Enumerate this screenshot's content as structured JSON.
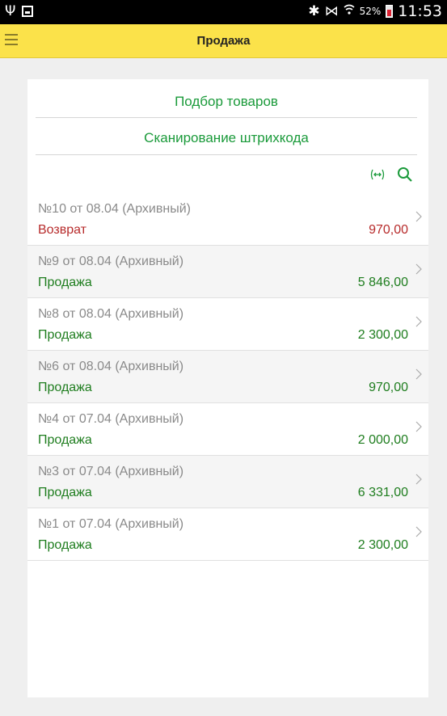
{
  "status_bar": {
    "battery": "52%",
    "time": "11:53"
  },
  "header": {
    "title": "Продажа"
  },
  "actions": {
    "pick_goods": "Подбор товаров",
    "scan_barcode": "Сканирование штрихкода"
  },
  "documents": [
    {
      "title": "№10 от 08.04 (Архивный)",
      "type": "Возврат",
      "amount": "970,00",
      "kind": "return"
    },
    {
      "title": "№9 от 08.04 (Архивный)",
      "type": "Продажа",
      "amount": "5 846,00",
      "kind": "sale"
    },
    {
      "title": "№8 от 08.04 (Архивный)",
      "type": "Продажа",
      "amount": "2 300,00",
      "kind": "sale"
    },
    {
      "title": "№6 от 08.04 (Архивный)",
      "type": "Продажа",
      "amount": "970,00",
      "kind": "sale"
    },
    {
      "title": "№4 от 07.04 (Архивный)",
      "type": "Продажа",
      "amount": "2 000,00",
      "kind": "sale"
    },
    {
      "title": "№3 от 07.04 (Архивный)",
      "type": "Продажа",
      "amount": "6 331,00",
      "kind": "sale"
    },
    {
      "title": "№1 от 07.04 (Архивный)",
      "type": "Продажа",
      "amount": "2 300,00",
      "kind": "sale"
    }
  ],
  "colors": {
    "header_bg": "#fbe24a",
    "action_green": "#1a9a3a",
    "sale_green": "#1e7d1e",
    "return_red": "#b72b2b"
  }
}
